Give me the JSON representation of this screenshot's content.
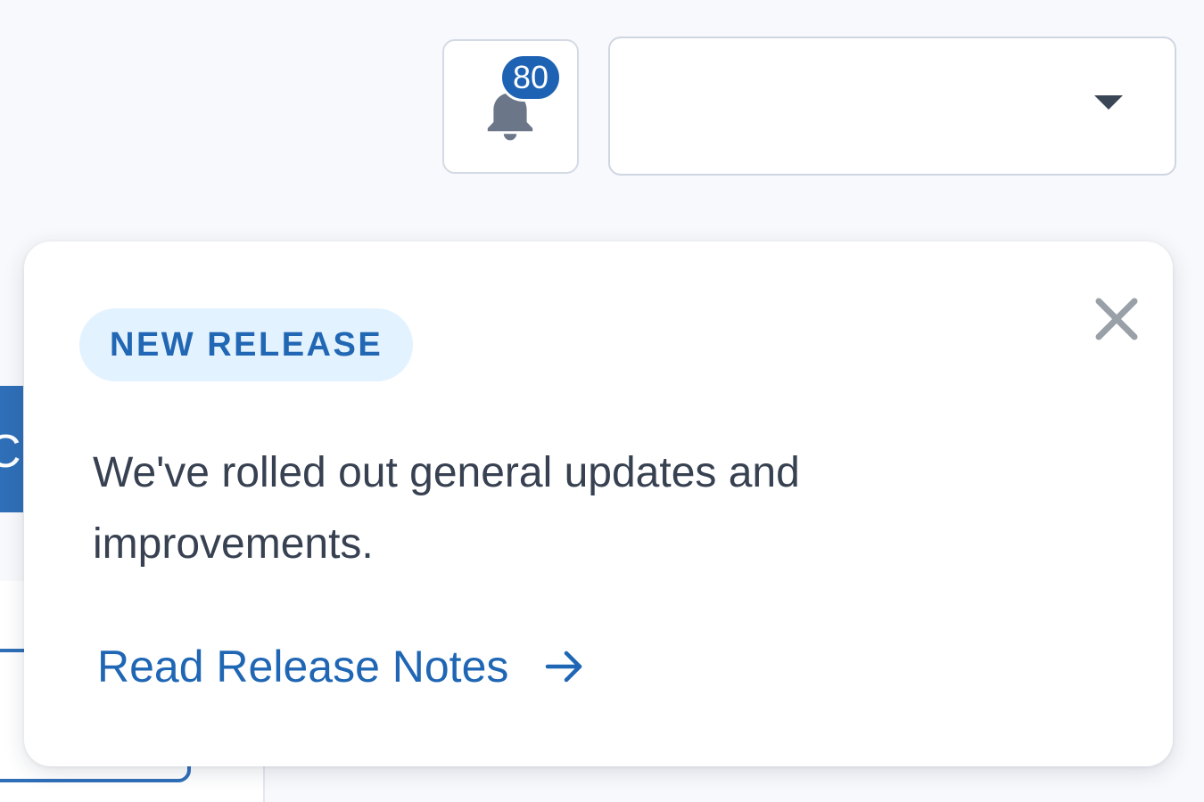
{
  "header": {
    "notifications": {
      "count": "80",
      "icon": "bell-icon",
      "badge_color": "#1e63b3",
      "icon_color": "#6b7789"
    },
    "account_select": {
      "value": "",
      "icon": "caret-down-icon"
    }
  },
  "background": {
    "blue_tab_text": "C",
    "accent_color": "#2f6fb7"
  },
  "release_popover": {
    "tag": "NEW RELEASE",
    "message": "We've rolled out general updates and improvements.",
    "link_label": "Read Release Notes",
    "link_icon": "arrow-right-icon",
    "close_icon": "close-icon",
    "tag_background": "#e3f2ff",
    "tag_color": "#2167b4",
    "link_color": "#1f66b4"
  }
}
